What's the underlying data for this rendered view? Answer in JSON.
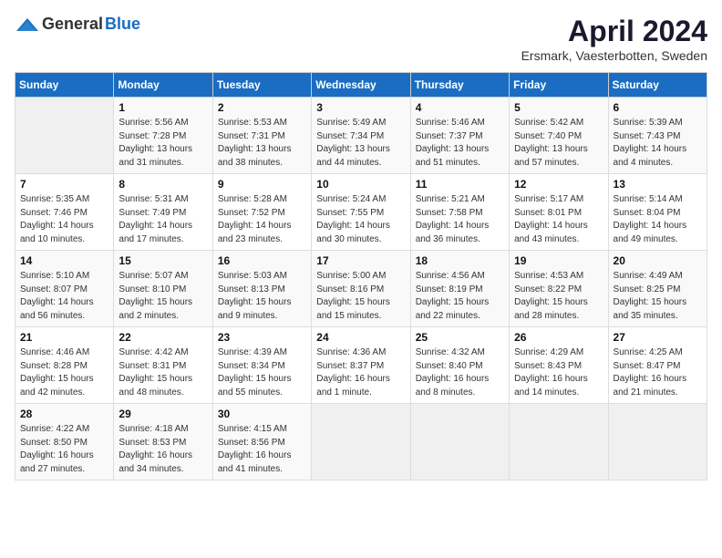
{
  "header": {
    "logo_general": "General",
    "logo_blue": "Blue",
    "month_title": "April 2024",
    "location": "Ersmark, Vaesterbotten, Sweden"
  },
  "days_of_week": [
    "Sunday",
    "Monday",
    "Tuesday",
    "Wednesday",
    "Thursday",
    "Friday",
    "Saturday"
  ],
  "weeks": [
    [
      {
        "day": "",
        "info": ""
      },
      {
        "day": "1",
        "info": "Sunrise: 5:56 AM\nSunset: 7:28 PM\nDaylight: 13 hours\nand 31 minutes."
      },
      {
        "day": "2",
        "info": "Sunrise: 5:53 AM\nSunset: 7:31 PM\nDaylight: 13 hours\nand 38 minutes."
      },
      {
        "day": "3",
        "info": "Sunrise: 5:49 AM\nSunset: 7:34 PM\nDaylight: 13 hours\nand 44 minutes."
      },
      {
        "day": "4",
        "info": "Sunrise: 5:46 AM\nSunset: 7:37 PM\nDaylight: 13 hours\nand 51 minutes."
      },
      {
        "day": "5",
        "info": "Sunrise: 5:42 AM\nSunset: 7:40 PM\nDaylight: 13 hours\nand 57 minutes."
      },
      {
        "day": "6",
        "info": "Sunrise: 5:39 AM\nSunset: 7:43 PM\nDaylight: 14 hours\nand 4 minutes."
      }
    ],
    [
      {
        "day": "7",
        "info": "Sunrise: 5:35 AM\nSunset: 7:46 PM\nDaylight: 14 hours\nand 10 minutes."
      },
      {
        "day": "8",
        "info": "Sunrise: 5:31 AM\nSunset: 7:49 PM\nDaylight: 14 hours\nand 17 minutes."
      },
      {
        "day": "9",
        "info": "Sunrise: 5:28 AM\nSunset: 7:52 PM\nDaylight: 14 hours\nand 23 minutes."
      },
      {
        "day": "10",
        "info": "Sunrise: 5:24 AM\nSunset: 7:55 PM\nDaylight: 14 hours\nand 30 minutes."
      },
      {
        "day": "11",
        "info": "Sunrise: 5:21 AM\nSunset: 7:58 PM\nDaylight: 14 hours\nand 36 minutes."
      },
      {
        "day": "12",
        "info": "Sunrise: 5:17 AM\nSunset: 8:01 PM\nDaylight: 14 hours\nand 43 minutes."
      },
      {
        "day": "13",
        "info": "Sunrise: 5:14 AM\nSunset: 8:04 PM\nDaylight: 14 hours\nand 49 minutes."
      }
    ],
    [
      {
        "day": "14",
        "info": "Sunrise: 5:10 AM\nSunset: 8:07 PM\nDaylight: 14 hours\nand 56 minutes."
      },
      {
        "day": "15",
        "info": "Sunrise: 5:07 AM\nSunset: 8:10 PM\nDaylight: 15 hours\nand 2 minutes."
      },
      {
        "day": "16",
        "info": "Sunrise: 5:03 AM\nSunset: 8:13 PM\nDaylight: 15 hours\nand 9 minutes."
      },
      {
        "day": "17",
        "info": "Sunrise: 5:00 AM\nSunset: 8:16 PM\nDaylight: 15 hours\nand 15 minutes."
      },
      {
        "day": "18",
        "info": "Sunrise: 4:56 AM\nSunset: 8:19 PM\nDaylight: 15 hours\nand 22 minutes."
      },
      {
        "day": "19",
        "info": "Sunrise: 4:53 AM\nSunset: 8:22 PM\nDaylight: 15 hours\nand 28 minutes."
      },
      {
        "day": "20",
        "info": "Sunrise: 4:49 AM\nSunset: 8:25 PM\nDaylight: 15 hours\nand 35 minutes."
      }
    ],
    [
      {
        "day": "21",
        "info": "Sunrise: 4:46 AM\nSunset: 8:28 PM\nDaylight: 15 hours\nand 42 minutes."
      },
      {
        "day": "22",
        "info": "Sunrise: 4:42 AM\nSunset: 8:31 PM\nDaylight: 15 hours\nand 48 minutes."
      },
      {
        "day": "23",
        "info": "Sunrise: 4:39 AM\nSunset: 8:34 PM\nDaylight: 15 hours\nand 55 minutes."
      },
      {
        "day": "24",
        "info": "Sunrise: 4:36 AM\nSunset: 8:37 PM\nDaylight: 16 hours\nand 1 minute."
      },
      {
        "day": "25",
        "info": "Sunrise: 4:32 AM\nSunset: 8:40 PM\nDaylight: 16 hours\nand 8 minutes."
      },
      {
        "day": "26",
        "info": "Sunrise: 4:29 AM\nSunset: 8:43 PM\nDaylight: 16 hours\nand 14 minutes."
      },
      {
        "day": "27",
        "info": "Sunrise: 4:25 AM\nSunset: 8:47 PM\nDaylight: 16 hours\nand 21 minutes."
      }
    ],
    [
      {
        "day": "28",
        "info": "Sunrise: 4:22 AM\nSunset: 8:50 PM\nDaylight: 16 hours\nand 27 minutes."
      },
      {
        "day": "29",
        "info": "Sunrise: 4:18 AM\nSunset: 8:53 PM\nDaylight: 16 hours\nand 34 minutes."
      },
      {
        "day": "30",
        "info": "Sunrise: 4:15 AM\nSunset: 8:56 PM\nDaylight: 16 hours\nand 41 minutes."
      },
      {
        "day": "",
        "info": ""
      },
      {
        "day": "",
        "info": ""
      },
      {
        "day": "",
        "info": ""
      },
      {
        "day": "",
        "info": ""
      }
    ]
  ]
}
